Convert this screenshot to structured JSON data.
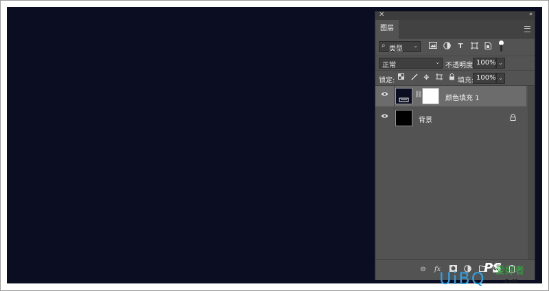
{
  "panel": {
    "close_glyph": "✕",
    "collapse_glyph": "‹‹",
    "tab_label": "图层"
  },
  "filter": {
    "kind_label": "类型",
    "icons": [
      "image-filter-icon",
      "adjustment-filter-icon",
      "type-filter-icon",
      "shape-filter-icon",
      "smart-object-filter-icon"
    ]
  },
  "blend": {
    "mode": "正常",
    "opacity_label": "不透明度:",
    "opacity_value": "100%"
  },
  "lock": {
    "label": "锁定:",
    "fill_label": "填充:",
    "fill_value": "100%"
  },
  "layers": [
    {
      "name": "颜色填充 1",
      "selected": true,
      "thumb_color": "#0b0e22",
      "mask_color": "#ffffff"
    },
    {
      "name": "背景",
      "selected": false,
      "thumb_color": "#000000",
      "locked": true
    }
  ],
  "footer_icons": [
    "link-layers-icon",
    "layer-style-icon",
    "add-mask-icon",
    "adjustment-layer-icon",
    "group-icon",
    "new-layer-icon",
    "delete-layer-icon"
  ],
  "watermark": {
    "ps": "PS",
    "sub": "爱好者",
    "site": "UiBQ",
    "com": ".CoM"
  },
  "colors": {
    "canvas": "#0b0e22",
    "panel_bg": "#535353",
    "selected_row": "#6c6c6c"
  }
}
